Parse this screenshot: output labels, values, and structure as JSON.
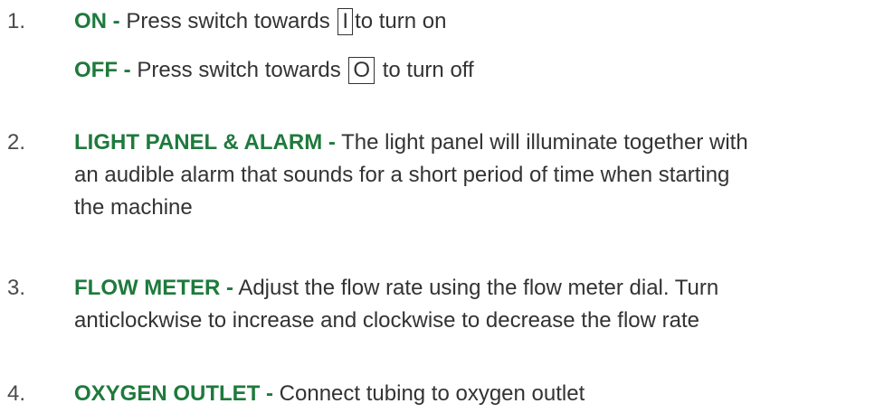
{
  "items": [
    {
      "number": "1.",
      "lines": [
        {
          "label": "ON -",
          "text_before": " Press switch towards ",
          "box": "I",
          "text_after": "to turn on"
        },
        {
          "label": "OFF -",
          "text_before": " Press switch towards ",
          "box": "O",
          "text_after": " to turn off"
        }
      ]
    },
    {
      "number": "2.",
      "label": "LIGHT PANEL & ALARM -",
      "text_lines": [
        " The light panel will illuminate together with",
        "an audible alarm that sounds for a short period of time when starting",
        "the machine"
      ]
    },
    {
      "number": "3.",
      "label": "FLOW METER -",
      "text_lines": [
        " Adjust the flow rate using the flow meter dial. Turn",
        "anticlockwise to increase and clockwise to decrease the flow rate"
      ]
    },
    {
      "number": "4.",
      "label": "OXYGEN OUTLET -",
      "text_lines": [
        " Connect tubing to oxygen outlet"
      ]
    }
  ]
}
